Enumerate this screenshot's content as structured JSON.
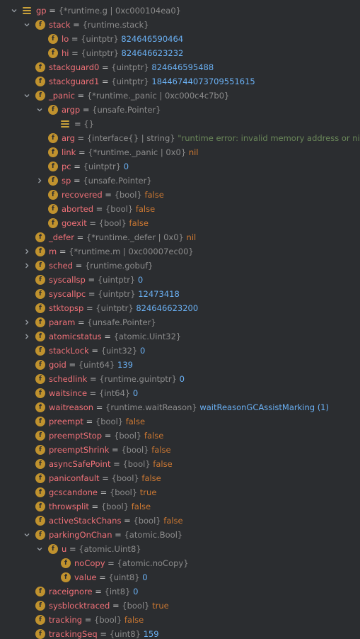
{
  "rows": [
    {
      "key": "gp",
      "icon": "list",
      "arrow": "open",
      "depth": 0,
      "name": "gp",
      "type": "{*runtime.g | 0xc000104ea0}",
      "value": "",
      "vcls": "num"
    },
    {
      "key": "stack",
      "icon": "field",
      "arrow": "open",
      "depth": 1,
      "name": "stack",
      "type": "{runtime.stack}",
      "value": "",
      "vcls": "num"
    },
    {
      "key": "lo",
      "icon": "field",
      "arrow": "none",
      "depth": 2,
      "name": "lo",
      "type": "{uintptr}",
      "value": "824646590464",
      "vcls": "num"
    },
    {
      "key": "hi",
      "icon": "field",
      "arrow": "none",
      "depth": 2,
      "name": "hi",
      "type": "{uintptr}",
      "value": "824646623232",
      "vcls": "num"
    },
    {
      "key": "stackguard0",
      "icon": "field",
      "arrow": "none",
      "depth": 1,
      "name": "stackguard0",
      "type": "{uintptr}",
      "value": "824646595488",
      "vcls": "num"
    },
    {
      "key": "stackguard1",
      "icon": "field",
      "arrow": "none",
      "depth": 1,
      "name": "stackguard1",
      "type": "{uintptr}",
      "value": "18446744073709551615",
      "vcls": "num"
    },
    {
      "key": "panic",
      "icon": "field",
      "arrow": "open",
      "depth": 1,
      "name": "_panic",
      "type": "{*runtime._panic | 0xc000c4c7b0}",
      "value": "",
      "vcls": "num"
    },
    {
      "key": "argp",
      "icon": "field",
      "arrow": "open",
      "depth": 2,
      "name": "argp",
      "type": "{unsafe.Pointer}",
      "value": "",
      "vcls": "num"
    },
    {
      "key": "argp-elem",
      "icon": "list",
      "arrow": "none",
      "depth": 3,
      "name": "",
      "type": "{}",
      "value": "",
      "vcls": "num"
    },
    {
      "key": "arg",
      "icon": "field",
      "arrow": "none",
      "depth": 2,
      "name": "arg",
      "type": "{interface{} | string}",
      "value": "\"runtime error: invalid memory address or nil pointer dereference\"",
      "vcls": "str"
    },
    {
      "key": "link",
      "icon": "field",
      "arrow": "none",
      "depth": 2,
      "name": "link",
      "type": "{*runtime._panic | 0x0}",
      "value": "nil",
      "vcls": "kw"
    },
    {
      "key": "pc",
      "icon": "field",
      "arrow": "none",
      "depth": 2,
      "name": "pc",
      "type": "{uintptr}",
      "value": "0",
      "vcls": "num"
    },
    {
      "key": "sp",
      "icon": "field",
      "arrow": "closed",
      "depth": 2,
      "name": "sp",
      "type": "{unsafe.Pointer}",
      "value": "",
      "vcls": "num"
    },
    {
      "key": "recovered",
      "icon": "field",
      "arrow": "none",
      "depth": 2,
      "name": "recovered",
      "type": "{bool}",
      "value": "false",
      "vcls": "kw"
    },
    {
      "key": "aborted",
      "icon": "field",
      "arrow": "none",
      "depth": 2,
      "name": "aborted",
      "type": "{bool}",
      "value": "false",
      "vcls": "kw"
    },
    {
      "key": "goexit",
      "icon": "field",
      "arrow": "none",
      "depth": 2,
      "name": "goexit",
      "type": "{bool}",
      "value": "false",
      "vcls": "kw"
    },
    {
      "key": "defer",
      "icon": "field",
      "arrow": "none",
      "depth": 1,
      "name": "_defer",
      "type": "{*runtime._defer | 0x0}",
      "value": "nil",
      "vcls": "kw"
    },
    {
      "key": "m",
      "icon": "field",
      "arrow": "closed",
      "depth": 1,
      "name": "m",
      "type": "{*runtime.m | 0xc00007ec00}",
      "value": "",
      "vcls": "num"
    },
    {
      "key": "sched",
      "icon": "field",
      "arrow": "closed",
      "depth": 1,
      "name": "sched",
      "type": "{runtime.gobuf}",
      "value": "",
      "vcls": "num"
    },
    {
      "key": "syscallsp",
      "icon": "field",
      "arrow": "none",
      "depth": 1,
      "name": "syscallsp",
      "type": "{uintptr}",
      "value": "0",
      "vcls": "num"
    },
    {
      "key": "syscallpc",
      "icon": "field",
      "arrow": "none",
      "depth": 1,
      "name": "syscallpc",
      "type": "{uintptr}",
      "value": "12473418",
      "vcls": "num"
    },
    {
      "key": "stktopsp",
      "icon": "field",
      "arrow": "none",
      "depth": 1,
      "name": "stktopsp",
      "type": "{uintptr}",
      "value": "824646623200",
      "vcls": "num"
    },
    {
      "key": "param",
      "icon": "field",
      "arrow": "closed",
      "depth": 1,
      "name": "param",
      "type": "{unsafe.Pointer}",
      "value": "",
      "vcls": "num"
    },
    {
      "key": "atomicstatus",
      "icon": "field",
      "arrow": "closed",
      "depth": 1,
      "name": "atomicstatus",
      "type": "{atomic.Uint32}",
      "value": "",
      "vcls": "num"
    },
    {
      "key": "stackLock",
      "icon": "field",
      "arrow": "none",
      "depth": 1,
      "name": "stackLock",
      "type": "{uint32}",
      "value": "0",
      "vcls": "num"
    },
    {
      "key": "goid",
      "icon": "field",
      "arrow": "none",
      "depth": 1,
      "name": "goid",
      "type": "{uint64}",
      "value": "139",
      "vcls": "num"
    },
    {
      "key": "schedlink",
      "icon": "field",
      "arrow": "none",
      "depth": 1,
      "name": "schedlink",
      "type": "{runtime.guintptr}",
      "value": "0",
      "vcls": "num"
    },
    {
      "key": "waitsince",
      "icon": "field",
      "arrow": "none",
      "depth": 1,
      "name": "waitsince",
      "type": "{int64}",
      "value": "0",
      "vcls": "num"
    },
    {
      "key": "waitreason",
      "icon": "field",
      "arrow": "none",
      "depth": 1,
      "name": "waitreason",
      "type": "{runtime.waitReason}",
      "value": "waitReasonGCAssistMarking (1)",
      "vcls": "enum"
    },
    {
      "key": "preempt",
      "icon": "field",
      "arrow": "none",
      "depth": 1,
      "name": "preempt",
      "type": "{bool}",
      "value": "false",
      "vcls": "kw"
    },
    {
      "key": "preemptStop",
      "icon": "field",
      "arrow": "none",
      "depth": 1,
      "name": "preemptStop",
      "type": "{bool}",
      "value": "false",
      "vcls": "kw"
    },
    {
      "key": "preemptShrink",
      "icon": "field",
      "arrow": "none",
      "depth": 1,
      "name": "preemptShrink",
      "type": "{bool}",
      "value": "false",
      "vcls": "kw"
    },
    {
      "key": "asyncSafePoint",
      "icon": "field",
      "arrow": "none",
      "depth": 1,
      "name": "asyncSafePoint",
      "type": "{bool}",
      "value": "false",
      "vcls": "kw"
    },
    {
      "key": "paniconfault",
      "icon": "field",
      "arrow": "none",
      "depth": 1,
      "name": "paniconfault",
      "type": "{bool}",
      "value": "false",
      "vcls": "kw"
    },
    {
      "key": "gcscandone",
      "icon": "field",
      "arrow": "none",
      "depth": 1,
      "name": "gcscandone",
      "type": "{bool}",
      "value": "true",
      "vcls": "kw"
    },
    {
      "key": "throwsplit",
      "icon": "field",
      "arrow": "none",
      "depth": 1,
      "name": "throwsplit",
      "type": "{bool}",
      "value": "false",
      "vcls": "kw"
    },
    {
      "key": "activeStackChans",
      "icon": "field",
      "arrow": "none",
      "depth": 1,
      "name": "activeStackChans",
      "type": "{bool}",
      "value": "false",
      "vcls": "kw"
    },
    {
      "key": "parkingOnChan",
      "icon": "field",
      "arrow": "open",
      "depth": 1,
      "name": "parkingOnChan",
      "type": "{atomic.Bool}",
      "value": "",
      "vcls": "num"
    },
    {
      "key": "u",
      "icon": "field",
      "arrow": "open",
      "depth": 2,
      "name": "u",
      "type": "{atomic.Uint8}",
      "value": "",
      "vcls": "num"
    },
    {
      "key": "noCopy",
      "icon": "field",
      "arrow": "none",
      "depth": 3,
      "name": "noCopy",
      "type": "{atomic.noCopy}",
      "value": "",
      "vcls": "num"
    },
    {
      "key": "value",
      "icon": "field",
      "arrow": "none",
      "depth": 3,
      "name": "value",
      "type": "{uint8}",
      "value": "0",
      "vcls": "num"
    },
    {
      "key": "raceignore",
      "icon": "field",
      "arrow": "none",
      "depth": 1,
      "name": "raceignore",
      "type": "{int8}",
      "value": "0",
      "vcls": "num"
    },
    {
      "key": "sysblocktraced",
      "icon": "field",
      "arrow": "none",
      "depth": 1,
      "name": "sysblocktraced",
      "type": "{bool}",
      "value": "true",
      "vcls": "kw"
    },
    {
      "key": "tracking",
      "icon": "field",
      "arrow": "none",
      "depth": 1,
      "name": "tracking",
      "type": "{bool}",
      "value": "false",
      "vcls": "kw"
    },
    {
      "key": "trackingSeq",
      "icon": "field",
      "arrow": "none",
      "depth": 1,
      "name": "trackingSeq",
      "type": "{uint8}",
      "value": "159",
      "vcls": "num"
    }
  ],
  "labels": {
    "equals": " = ",
    "field_icon_letter": "f"
  },
  "colors": {
    "background": "#2b2d30",
    "field_icon": "#c0922e",
    "name": "#f07178",
    "type": "#8c8c8c",
    "number": "#6ab0f3",
    "keyword": "#cc7832",
    "string": "#6a8759"
  }
}
